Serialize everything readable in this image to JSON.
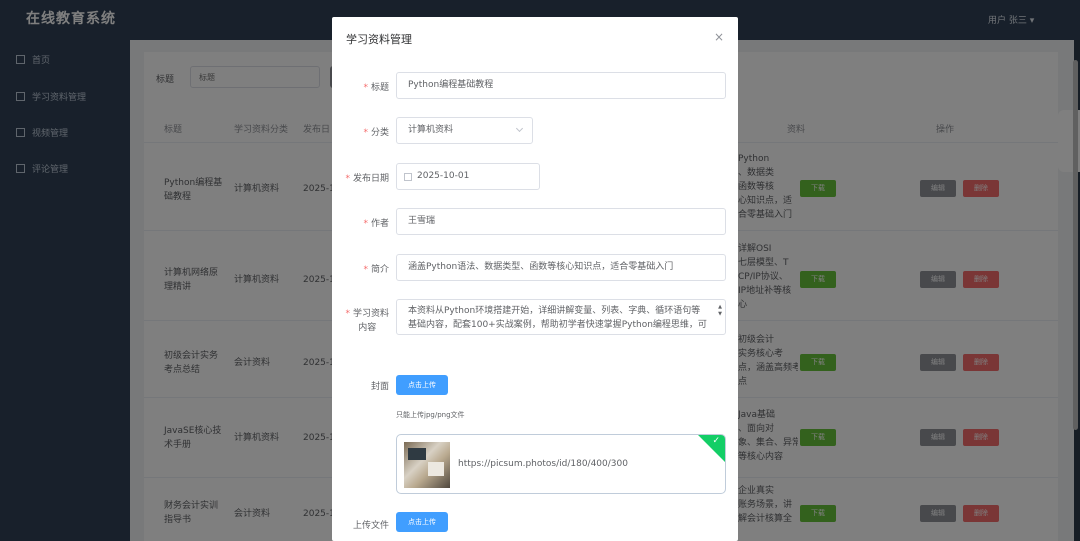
{
  "app": {
    "title": "在线教育系统",
    "user": "用户 张三 ▾"
  },
  "sidebar": {
    "items": [
      {
        "label": "首页"
      },
      {
        "label": "学习资料管理"
      },
      {
        "label": "视频管理"
      },
      {
        "label": "评论管理"
      }
    ]
  },
  "search": {
    "label": "标题",
    "placeholder": "标题"
  },
  "table": {
    "headers": [
      "标题",
      "学习资料分类",
      "发布日",
      "资料",
      "操作"
    ],
    "rows": [
      {
        "title_l1": "Python编程基",
        "title_l2": "础教程",
        "category": "计算机资料",
        "date": "2025-1",
        "desc": [
          "Python",
          "、数据类",
          "函数等核",
          "心知识点，适",
          "合零基础入门"
        ]
      },
      {
        "title_l1": "计算机网络原",
        "title_l2": "理精讲",
        "category": "计算机资料",
        "date": "2025-1",
        "desc": [
          "详解OSI",
          "七层模型、T",
          "CP/IP协议、",
          "IP地址补等核",
          "心"
        ]
      },
      {
        "title_l1": "初级会计实务",
        "title_l2": "考点总结",
        "category": "会计资料",
        "date": "2025-1",
        "desc": [
          "初级会计",
          "实务核心考",
          "点，涵盖高频考",
          "点"
        ]
      },
      {
        "title_l1": "JavaSE核心技",
        "title_l2": "术手册",
        "category": "计算机资料",
        "date": "2025-1",
        "desc": [
          "Java基础",
          "、面向对",
          "象、集合、异常",
          "等核心内容"
        ]
      },
      {
        "title_l1": "财务会计实训",
        "title_l2": "指导书",
        "category": "会计资料",
        "date": "2025-1",
        "desc": [
          "企业真实",
          "账务场景，讲",
          "解会计核算全"
        ]
      }
    ],
    "btn_download": "下载",
    "btn_edit": "编辑",
    "btn_delete": "删除"
  },
  "dialog": {
    "title": "学习资料管理",
    "close": "×",
    "required_mark": "*",
    "fields": {
      "title": {
        "label": "标题",
        "value": "Python编程基础教程"
      },
      "category": {
        "label": "分类",
        "value": "计算机资料"
      },
      "date": {
        "label": "发布日期",
        "value": "2025-10-01"
      },
      "author": {
        "label": "作者",
        "value": "王雪瑞"
      },
      "summary": {
        "label": "简介",
        "value": "涵盖Python语法、数据类型、函数等核心知识点，适合零基础入门"
      },
      "content": {
        "label_l1": "学习资料",
        "label_l2": "内容",
        "value": "本资料从Python环境搭建开始，详细讲解变量、列表、字典、循环语句等基础内容，配套100+实战案例，帮助初学者快速掌握Python编程思维，可"
      },
      "cover": {
        "label": "封面",
        "button": "点击上传",
        "tip": "只能上传jpg/png文件",
        "file_url": "https://picsum.photos/id/180/400/300"
      },
      "file": {
        "label": "上传文件",
        "button": "点击上传"
      }
    }
  }
}
